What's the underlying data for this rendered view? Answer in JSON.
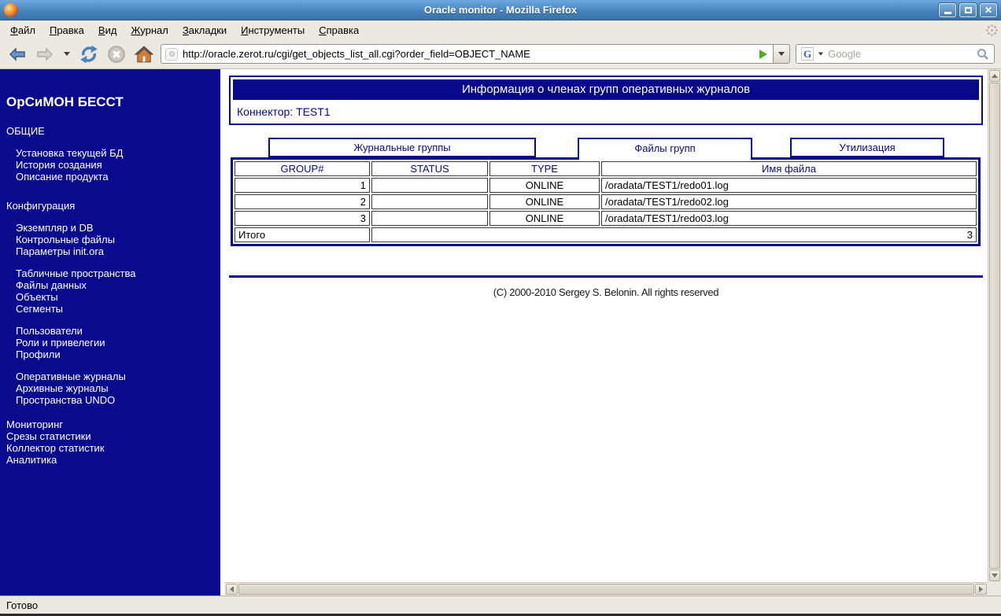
{
  "window": {
    "title": "Oracle monitor - Mozilla Firefox",
    "buttons": {
      "minimize": "minimize",
      "maximize": "maximize",
      "close": "×"
    }
  },
  "menu_bar": {
    "items": [
      {
        "name": "file",
        "label": "Файл"
      },
      {
        "name": "edit",
        "label": "Правка"
      },
      {
        "name": "view",
        "label": "Вид"
      },
      {
        "name": "history",
        "label": "Журнал"
      },
      {
        "name": "bookmarks",
        "label": "Закладки"
      },
      {
        "name": "tools",
        "label": "Инструменты"
      },
      {
        "name": "help",
        "label": "Справка"
      }
    ]
  },
  "toolbar": {
    "url": "http://oracle.zerot.ru/cgi/get_objects_list_all.cgi?order_field=OBJECT_NAME",
    "search_placeholder": "Google",
    "search_engine": "G"
  },
  "sidebar": {
    "title": "ОрСиМОН БЕССТ",
    "blocks": [
      {
        "type": "header",
        "label": "ОБЩИЕ"
      },
      {
        "type": "links",
        "items": [
          "Установка текущей БД",
          "История создания",
          "Описание продукта"
        ]
      },
      {
        "type": "header",
        "label": "Конфигурация"
      },
      {
        "type": "links",
        "items": [
          "Экземпляр и DB",
          "Контрольные файлы",
          "Параметры init.ora"
        ]
      },
      {
        "type": "links",
        "items": [
          "Табличные пространства",
          "Файлы данных",
          "Объекты",
          "Сегменты"
        ]
      },
      {
        "type": "links",
        "items": [
          "Пользователи",
          "Роли и привелегии",
          "Профили"
        ]
      },
      {
        "type": "links",
        "items": [
          "Оперативные журналы",
          "Архивные журналы",
          "Пространства UNDO"
        ]
      },
      {
        "type": "plain",
        "items": [
          "Мониторинг",
          "Срезы статистики",
          "Коллектор статистик",
          "Аналитика"
        ]
      }
    ]
  },
  "content": {
    "page_header": {
      "title": "Информация о членах групп оперативных журналов",
      "connector": "Коннектор: TEST1"
    },
    "tabs": [
      {
        "name": "tab-journal-groups",
        "label": "Журнальные группы",
        "active": false
      },
      {
        "name": "tab-group-files",
        "label": "Файлы групп",
        "active": true
      },
      {
        "name": "tab-utilization",
        "label": "Утилизация",
        "active": false
      }
    ],
    "table": {
      "columns": [
        "GROUP#",
        "STATUS",
        "TYPE",
        "Имя файла"
      ],
      "rows": [
        [
          "1",
          "",
          "ONLINE",
          "/oradata/TEST1/redo01.log"
        ],
        [
          "2",
          "",
          "ONLINE",
          "/oradata/TEST1/redo02.log"
        ],
        [
          "3",
          "",
          "ONLINE",
          "/oradata/TEST1/redo03.log"
        ]
      ],
      "total_label": "Итого",
      "total_value": "3"
    },
    "footer": "(C) 2000-2010 Sergey S. Belonin. All rights reserved"
  },
  "status_bar": {
    "text": "Готово"
  },
  "colors": {
    "navy": "#08088a",
    "sidebar_bg": "#0a0a8e",
    "chrome_bg": "#ede9e1",
    "titlebar_top": "#6ea7e0",
    "titlebar_bottom": "#3a71a8",
    "go_arrow_green": "#55ab21",
    "white": "#ffffff"
  }
}
